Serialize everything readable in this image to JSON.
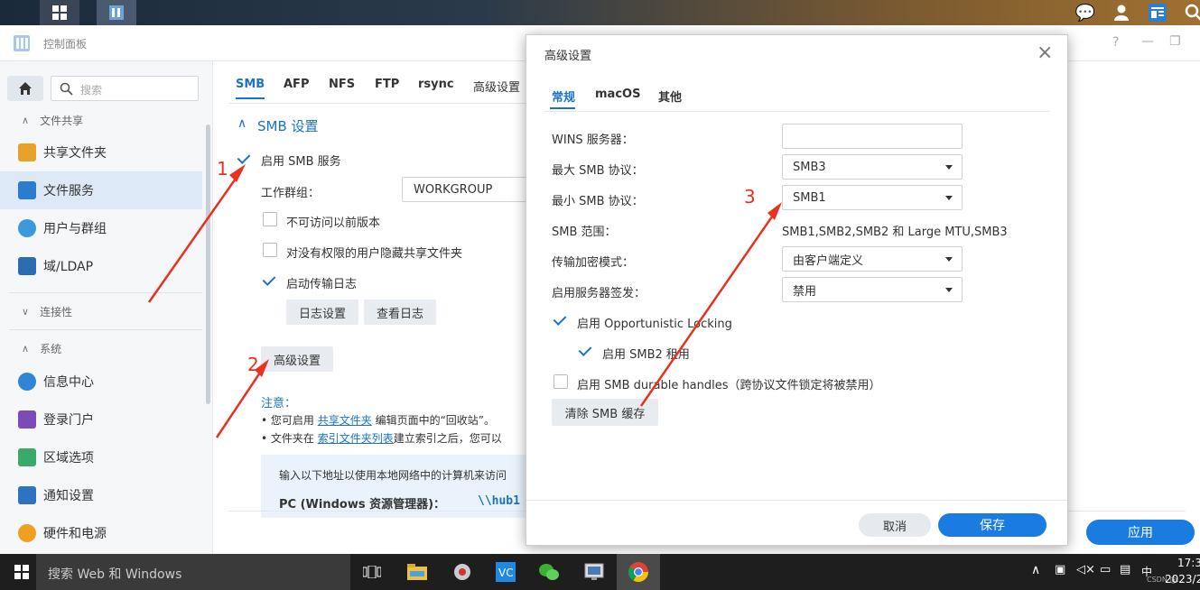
{
  "window": {
    "title": "控制面板",
    "help": "?",
    "minimize": "—",
    "maximize": "❐"
  },
  "sidebar": {
    "search_placeholder": "搜索",
    "cat_file_share": "文件共享",
    "items": [
      {
        "label": "共享文件夹",
        "color": "#e9a12a"
      },
      {
        "label": "文件服务",
        "color": "#2b7bd1"
      },
      {
        "label": "用户与群组",
        "color": "#3b99d9"
      },
      {
        "label": "域/LDAP",
        "color": "#2b6cb0"
      }
    ],
    "cat_connectivity": "连接性",
    "cat_system": "系统",
    "sys_items": [
      {
        "label": "信息中心",
        "color": "#2f86d6"
      },
      {
        "label": "登录门户",
        "color": "#7b4bb8"
      },
      {
        "label": "区域选项",
        "color": "#3aa96a"
      },
      {
        "label": "通知设置",
        "color": "#2e72c2"
      },
      {
        "label": "硬件和电源",
        "color": "#f0a020"
      }
    ]
  },
  "main": {
    "tabs": [
      "SMB",
      "AFP",
      "NFS",
      "FTP",
      "rsync",
      "高级设置"
    ],
    "section_title": "SMB 设置",
    "enable_smb": "启用 SMB 服务",
    "workgroup_label": "工作群组：",
    "workgroup_value": "WORKGROUP",
    "opt_prev_versions": "不可访问以前版本",
    "opt_hide_shares": "对没有权限的用户隐藏共享文件夹",
    "opt_transfer_log": "启动传输日志",
    "btn_log_settings": "日志设置",
    "btn_view_log": "查看日志",
    "btn_advanced": "高级设置",
    "note_title": "注意：",
    "note1_pre": "您可启用",
    "note1_link": "共享文件夹",
    "note1_post": "编辑页面中的“回收站”。",
    "note2_pre": "文件夹在",
    "note2_link": "索引文件夹列表",
    "note2_post": "建立索引之后，您可以",
    "info_text": "输入以下地址以使用本地网络中的计算机来访问",
    "info_pc_label": "PC (Windows 资源管理器)：",
    "info_pc_value": "\\\\hub1",
    "apply": "应用"
  },
  "dialog": {
    "title": "高级设置",
    "close": "×",
    "tabs": [
      "常规",
      "macOS",
      "其他"
    ],
    "wins_label": "WINS 服务器：",
    "wins_value": "",
    "max_label": "最大 SMB 协议：",
    "max_value": "SMB3",
    "min_label": "最小 SMB 协议：",
    "min_value": "SMB1",
    "range_label": "SMB 范围：",
    "range_value": "SMB1,SMB2,SMB2 和 Large MTU,SMB3",
    "enc_label": "传输加密模式：",
    "enc_value": "由客户端定义",
    "sign_label": "启用服务器签发：",
    "sign_value": "禁用",
    "oplock": "启用 Opportunistic Locking",
    "smb2_lease": "启用 SMB2 租用",
    "durable": "启用 SMB durable handles（跨协议文件锁定将被禁用）",
    "clear_cache": "清除 SMB 缓存",
    "cancel": "取消",
    "save": "保存"
  },
  "annotations": {
    "n1": "1",
    "n2": "2",
    "n3": "3"
  },
  "taskbar": {
    "search": "搜索 Web 和 Windows",
    "ime": "中",
    "time": "17:3",
    "date": "2023/2",
    "watermark": "CSDN @..."
  },
  "colors": {
    "accent": "#1a73c9",
    "primary_btn": "#1a7be0",
    "annotation": "#e8321f"
  }
}
